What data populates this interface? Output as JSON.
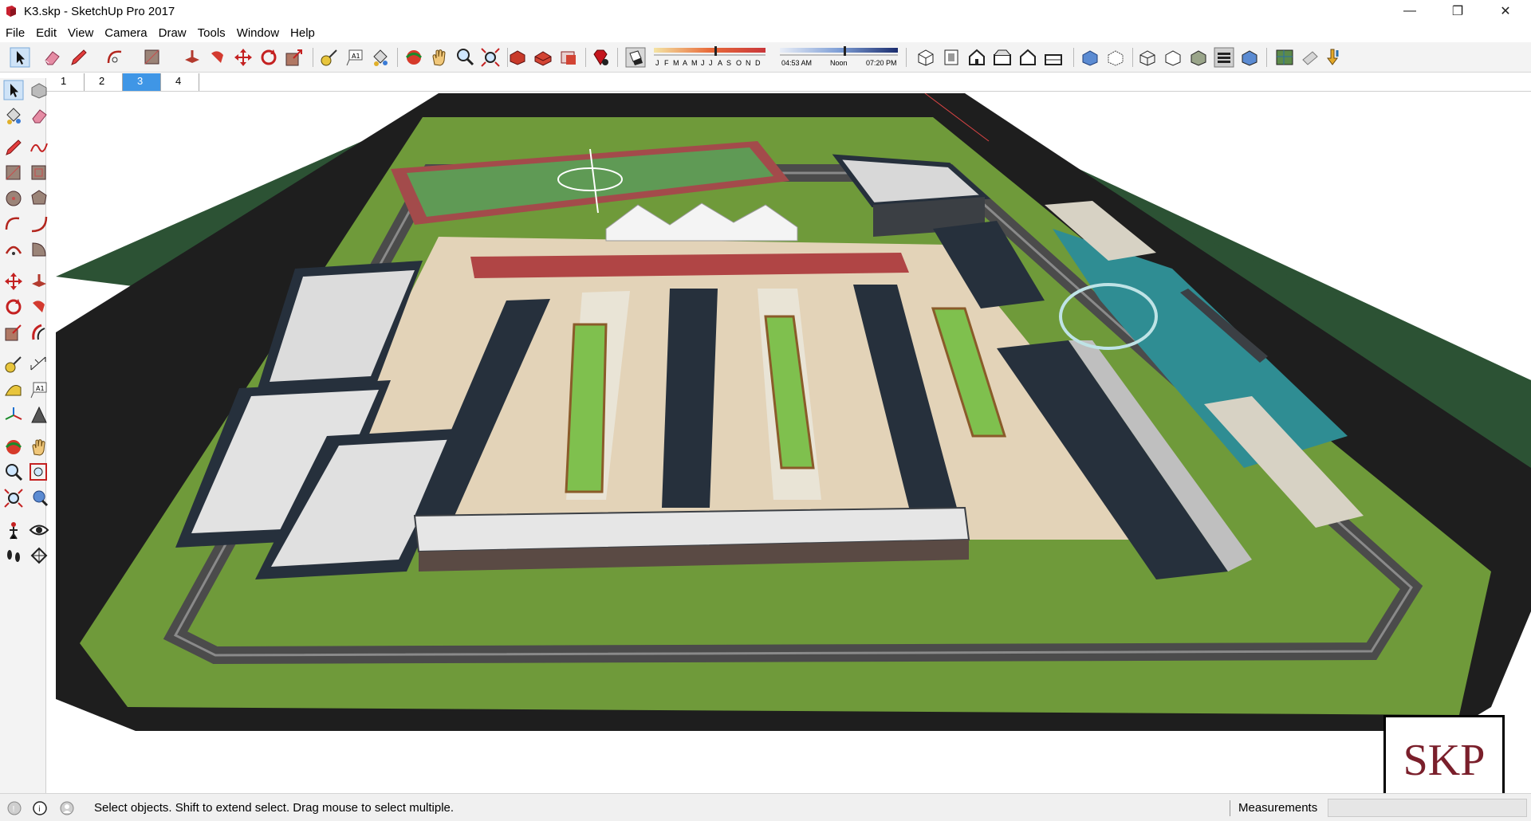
{
  "window": {
    "title": "K3.skp - SketchUp Pro 2017",
    "minimize_glyph": "—",
    "maximize_glyph": "❐",
    "close_glyph": "✕"
  },
  "menu": [
    "File",
    "Edit",
    "View",
    "Camera",
    "Draw",
    "Tools",
    "Window",
    "Help"
  ],
  "toolbar": {
    "icons": [
      "select-icon",
      "eraser-icon",
      "pencil-line-icon",
      "arc-icon",
      "shape-icon",
      "push-pull-icon",
      "follow-me-icon",
      "move-icon",
      "rotate-icon",
      "scale-icon",
      "tape-measure-icon",
      "text-icon",
      "paint-bucket-icon",
      "orbit-icon",
      "pan-icon",
      "zoom-icon",
      "zoom-extents-icon",
      "warehouse-icon",
      "extension-warehouse-icon",
      "layout-icon",
      "ruby-icon",
      "shadow-toggle-icon",
      "iso-view-icon",
      "top-view-icon",
      "front-view-icon",
      "right-view-icon",
      "back-view-icon",
      "left-view-icon",
      "xray-icon",
      "back-edges-icon",
      "wireframe-icon",
      "hidden-line-icon",
      "shaded-icon",
      "shaded-textures-icon",
      "monochrome-icon",
      "geo-location-icon",
      "3d-text-icon",
      "download-icon"
    ],
    "shadow": {
      "months": [
        "J",
        "F",
        "M",
        "A",
        "M",
        "J",
        "J",
        "A",
        "S",
        "O",
        "N",
        "D"
      ],
      "time_start": "04:53 AM",
      "time_mid": "Noon",
      "time_end": "07:20 PM"
    }
  },
  "scenes": {
    "tabs": [
      "1",
      "2",
      "3",
      "4"
    ],
    "active_index": 2
  },
  "left_tools": [
    "select-icon",
    "component-icon",
    "paint-bucket-icon",
    "eraser-icon",
    "line-icon",
    "freehand-icon",
    "rectangle-icon",
    "rotated-rectangle-icon",
    "circle-icon",
    "polygon-icon",
    "arc-icon",
    "two-point-arc-icon",
    "three-point-arc-icon",
    "pie-icon",
    "move-icon",
    "push-pull-icon",
    "rotate-icon",
    "follow-me-icon",
    "scale-icon",
    "offset-icon",
    "tape-measure-icon",
    "dimension-icon",
    "protractor-icon",
    "text-icon",
    "axes-icon",
    "3d-text-icon",
    "orbit-icon",
    "pan-icon",
    "zoom-icon",
    "zoom-window-icon",
    "zoom-extents-icon",
    "previous-view-icon",
    "position-camera-icon",
    "look-around-icon",
    "walk-icon",
    "section-plane-icon"
  ],
  "status": {
    "hint": "Select objects. Shift to extend select. Drag mouse to select multiple.",
    "measurements_label": "Measurements",
    "measurements_value": ""
  },
  "badge": {
    "text": "SKP"
  },
  "colors": {
    "grass": "#6f9a3a",
    "dark_grass": "#2c5234",
    "road": "#1e1e1e",
    "roof": "#26303c",
    "water": "#2f8d93",
    "track": "#a34b4b",
    "plaza": "#e3d3b8",
    "brand": "#7a1f2b",
    "active_tab": "#3f96e6"
  }
}
